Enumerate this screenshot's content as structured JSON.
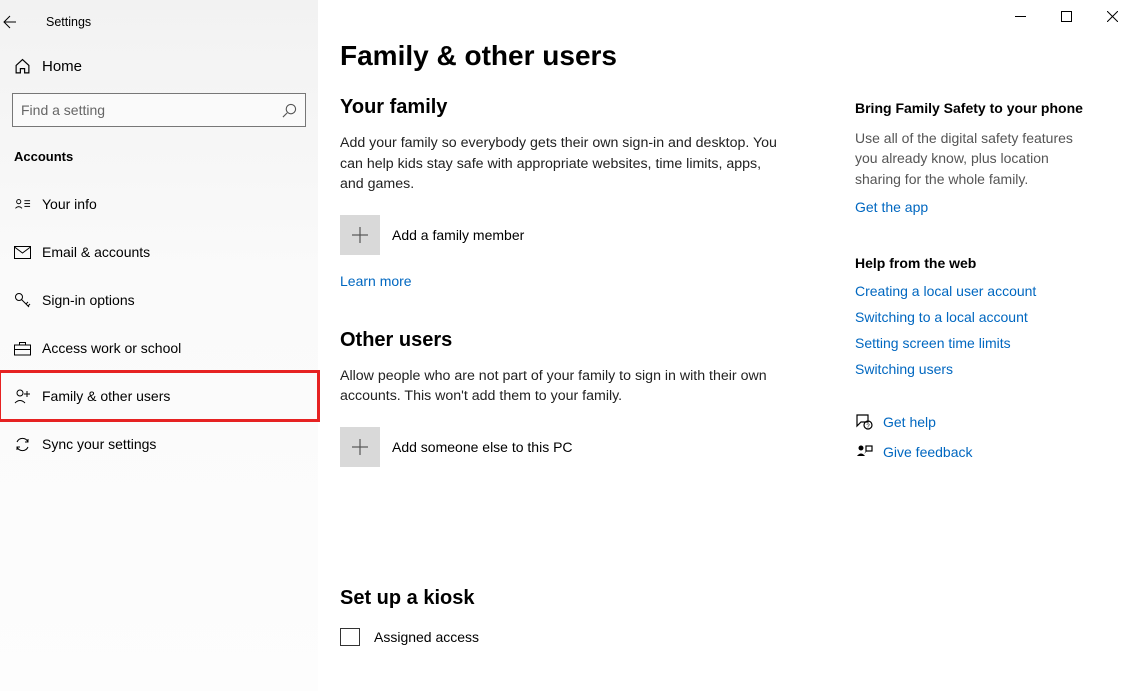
{
  "app_title": "Settings",
  "home_label": "Home",
  "search_placeholder": "Find a setting",
  "section_label": "Accounts",
  "nav": [
    {
      "label": "Your info"
    },
    {
      "label": "Email & accounts"
    },
    {
      "label": "Sign-in options"
    },
    {
      "label": "Access work or school"
    },
    {
      "label": "Family & other users"
    },
    {
      "label": "Sync your settings"
    }
  ],
  "page_title": "Family & other users",
  "family": {
    "heading": "Your family",
    "body": "Add your family so everybody gets their own sign-in and desktop. You can help kids stay safe with appropriate websites, time limits, apps, and games.",
    "add_label": "Add a family member",
    "learn_more": "Learn more"
  },
  "other": {
    "heading": "Other users",
    "body": "Allow people who are not part of your family to sign in with their own accounts. This won't add them to your family.",
    "add_label": "Add someone else to this PC"
  },
  "kiosk": {
    "heading": "Set up a kiosk",
    "assigned": "Assigned access"
  },
  "side1": {
    "heading": "Bring Family Safety to your phone",
    "body": "Use all of the digital safety features you already know, plus location sharing for the whole family.",
    "link": "Get the app"
  },
  "side2": {
    "heading": "Help from the web",
    "links": [
      "Creating a local user account",
      "Switching to a local account",
      "Setting screen time limits",
      "Switching users"
    ]
  },
  "help_link": "Get help",
  "feedback_link": "Give feedback"
}
